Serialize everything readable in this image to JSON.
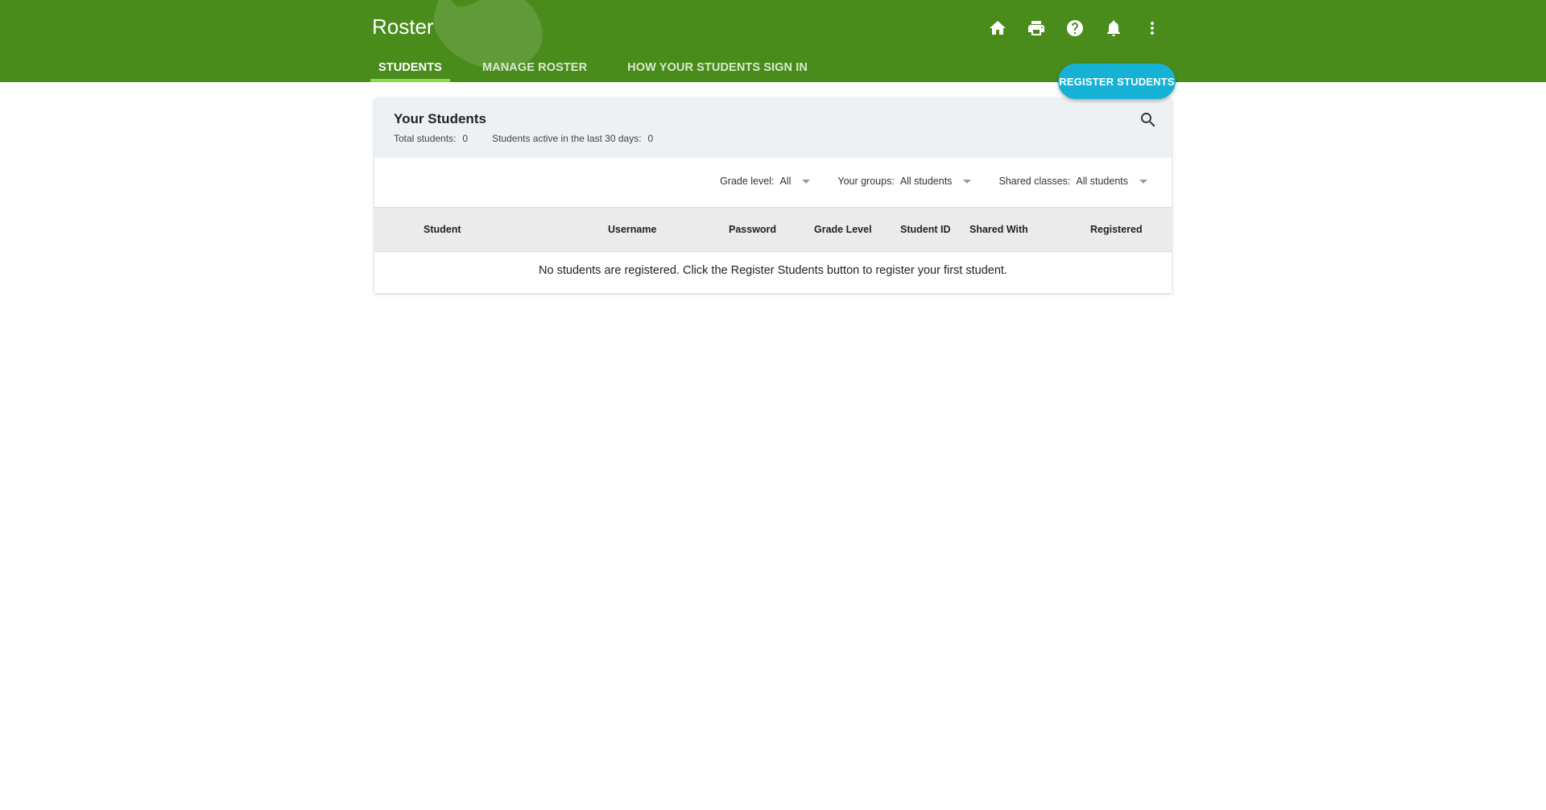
{
  "header": {
    "title": "Roster",
    "background_color": "#4a8c1c",
    "icons": [
      "home-icon",
      "print-icon",
      "help-icon",
      "notifications-icon",
      "more-vert-icon"
    ]
  },
  "tabs": [
    {
      "label": "STUDENTS",
      "active": true
    },
    {
      "label": "MANAGE ROSTER",
      "active": false
    },
    {
      "label": "HOW YOUR STUDENTS SIGN IN",
      "active": false
    }
  ],
  "register_button": {
    "label": "REGISTER STUDENTS",
    "color": "#16b2d5"
  },
  "card": {
    "title": "Your Students",
    "stats": {
      "total_label": "Total students:",
      "total_value": "0",
      "active_label": "Students active in the last 30 days:",
      "active_value": "0"
    },
    "filters": [
      {
        "label": "Grade level:",
        "value": "All"
      },
      {
        "label": "Your groups:",
        "value": "All students"
      },
      {
        "label": "Shared classes:",
        "value": "All students"
      }
    ],
    "columns": [
      "Student",
      "Username",
      "Password",
      "Grade Level",
      "Student ID",
      "Shared With",
      "Registered"
    ],
    "empty_message": "No students are registered. Click the Register Students button to register your first student."
  }
}
